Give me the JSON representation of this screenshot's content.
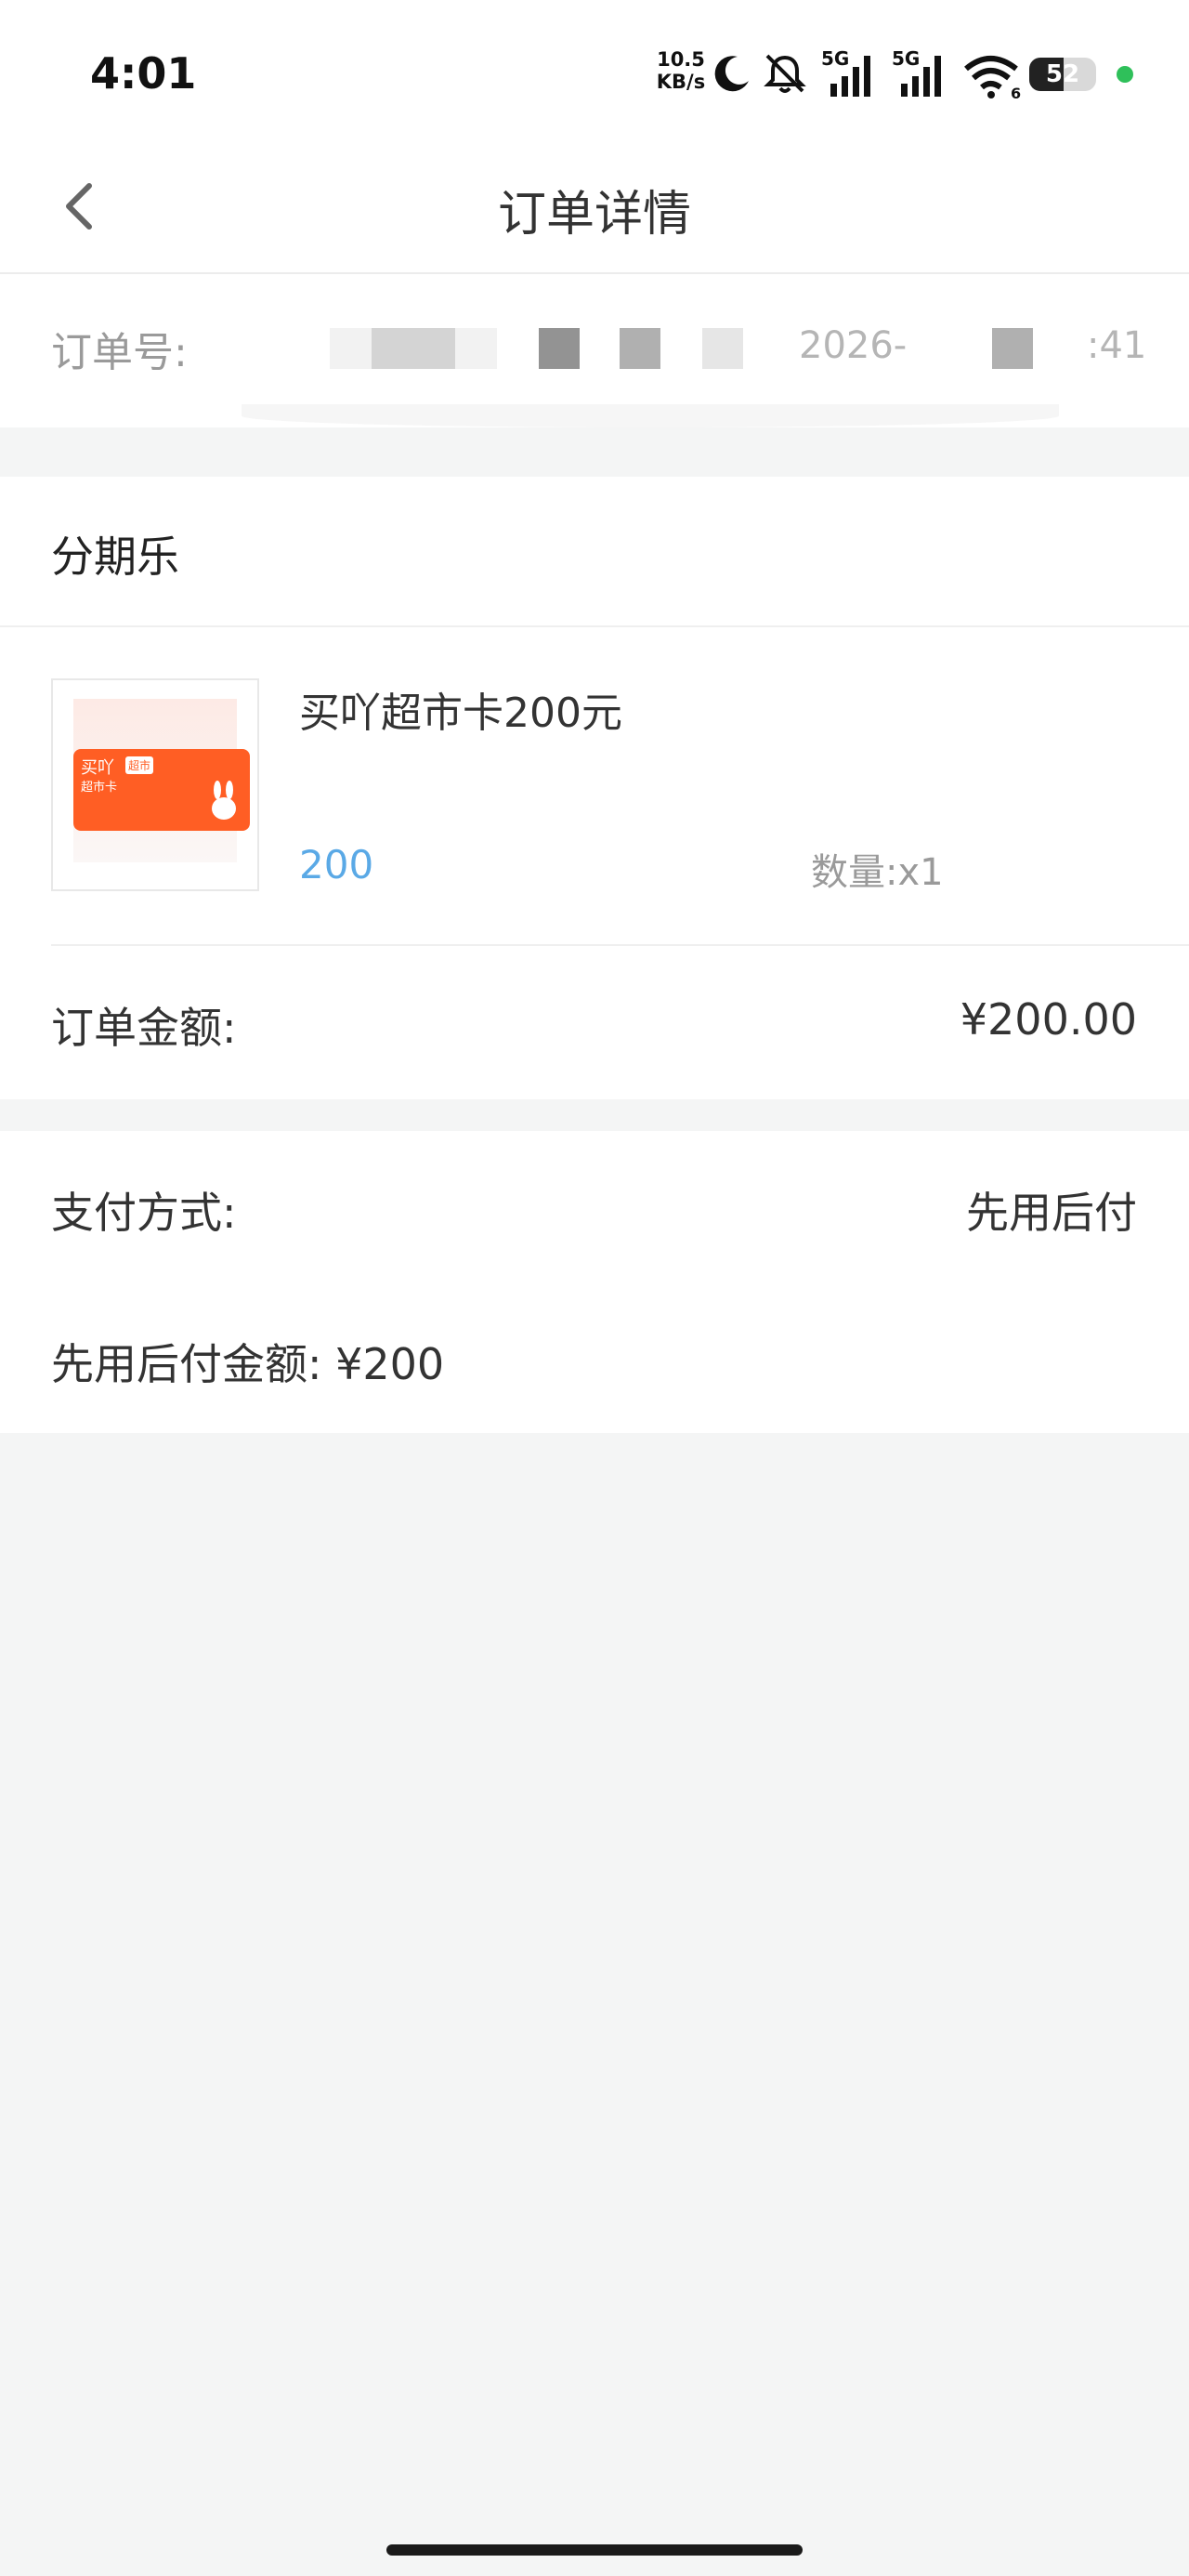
{
  "status_bar": {
    "time": "4:01",
    "net_speed_value": "10.5",
    "net_speed_unit": "KB/s",
    "battery": "52",
    "signal1_label": "5G",
    "signal2_label": "5G",
    "wifi_label": "6"
  },
  "header": {
    "title": "订单详情",
    "back_icon": "chevron-left-icon"
  },
  "order": {
    "number_label": "订单号:",
    "date_fragment": "2026-",
    "time_fragment": ":41"
  },
  "store": {
    "name": "分期乐"
  },
  "product": {
    "name": "买吖超市卡200元",
    "price": "200",
    "quantity": "数量:x1",
    "thumb_brand": "买吖",
    "thumb_tag": "超市",
    "thumb_sub": "超市卡"
  },
  "order_amount": {
    "label": "订单金额:",
    "value": "¥200.00"
  },
  "payment": {
    "method_label": "支付方式:",
    "method_value": "先用后付",
    "amount_text": "先用后付金额: ¥200"
  },
  "colors": {
    "price_accent": "#5aa9e6",
    "card_orange": "#ff5e24",
    "background": "#f4f5f5"
  }
}
